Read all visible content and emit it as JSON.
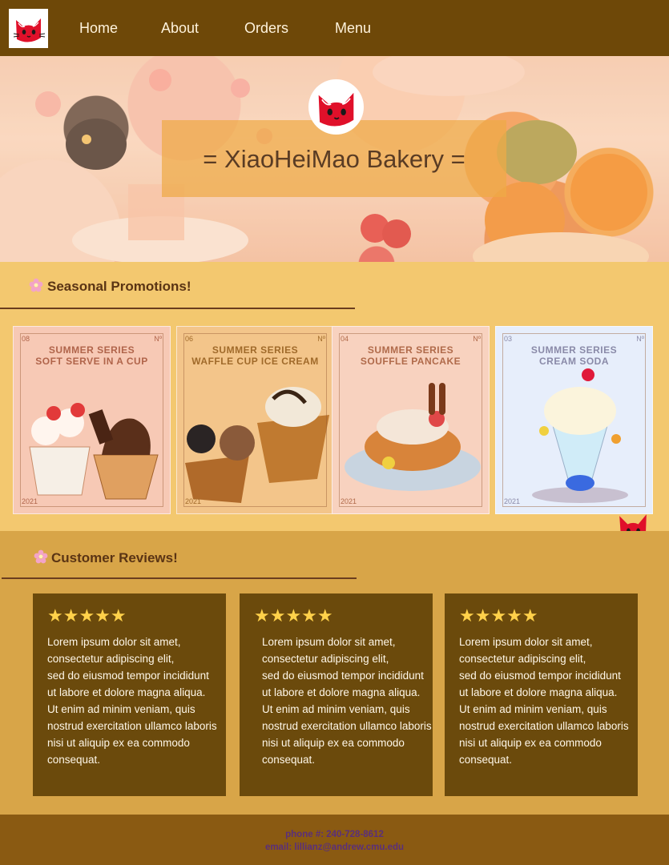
{
  "nav": {
    "logo": "black-cat-logo",
    "links": [
      "Home",
      "About",
      "Orders",
      "Menu"
    ]
  },
  "hero": {
    "title": "= XiaoHeiMao Bakery =",
    "badge": "black-cat-logo"
  },
  "promotions": {
    "heading": "Seasonal Promotions!",
    "icon": "flower-icon",
    "cards": [
      {
        "number_left": "08",
        "number_right": "Nº",
        "title_top": "SUMMER SERIES",
        "title": "SOFT SERVE IN A CUP",
        "year": "2021",
        "tint": "#f7c9b5"
      },
      {
        "number_left": "06",
        "number_right": "Nº",
        "title_top": "SUMMER SERIES",
        "title": "WAFFLE CUP ICE CREAM",
        "year": "2021",
        "tint": "#f3c58a"
      },
      {
        "number_left": "04",
        "number_right": "Nº",
        "title_top": "SUMMER SERIES",
        "title": "SOUFFLE PANCAKE",
        "year": "2021",
        "tint": "#f8d2bf"
      },
      {
        "number_left": "03",
        "number_right": "Nº",
        "title_top": "SUMMER SERIES",
        "title": "CREAM SODA",
        "year": "2021",
        "tint": "#e7eefb"
      }
    ]
  },
  "reviews": {
    "heading": "Customer Reviews!",
    "icon": "flower-icon",
    "items": [
      {
        "stars": "★★★★★",
        "lines": [
          "Lorem ipsum dolor sit amet,",
          "consectetur adipiscing elit,",
          "sed do eiusmod tempor incididunt",
          "ut labore et dolore magna aliqua.",
          "Ut enim ad minim veniam, quis",
          "nostrud exercitation ullamco laboris",
          "nisi ut aliquip ex ea commodo",
          "consequat."
        ]
      },
      {
        "stars": "★★★★★",
        "lines": [
          "Lorem ipsum dolor sit amet,",
          "consectetur adipiscing elit,",
          "sed do eiusmod tempor incididunt",
          "ut labore et dolore magna aliqua.",
          "Ut enim ad minim veniam, quis",
          "nostrud exercitation ullamco laboris",
          "nisi ut aliquip ex ea commodo",
          "consequat."
        ]
      },
      {
        "stars": "★★★★★",
        "lines": [
          "Lorem ipsum dolor sit amet,",
          "consectetur adipiscing elit,",
          "sed do eiusmod tempor incididunt",
          "ut labore et dolore magna aliqua.",
          "Ut enim ad minim veniam, quis",
          "nostrud exercitation ullamco laboris",
          "nisi ut aliquip ex ea commodo",
          "consequat."
        ]
      }
    ]
  },
  "footer": {
    "phone": "phone #: 240-728-8612",
    "email": "email: lillianz@andrew.cmu.edu"
  },
  "colors": {
    "nav_bg": "#6e4808",
    "promo_bg": "#f3c86f",
    "reviews_bg": "#d8a548",
    "card_bg": "#6b4a0c",
    "star": "#ffd14a",
    "cat_red": "#e0102a"
  }
}
